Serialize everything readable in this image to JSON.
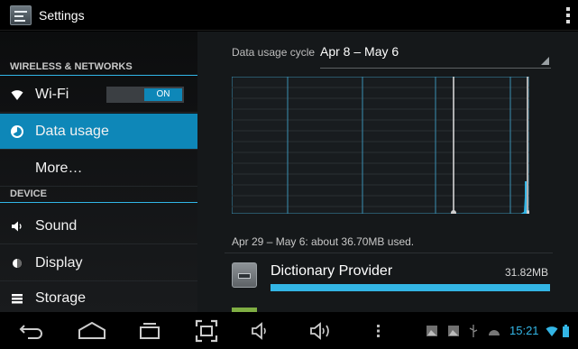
{
  "actionbar": {
    "title": "Settings"
  },
  "sidebar": {
    "sections": [
      {
        "header": "WIRELESS & NETWORKS"
      },
      {
        "header": "DEVICE"
      }
    ],
    "items": [
      {
        "label": "Wi-Fi",
        "icon": "wifi-icon",
        "toggle": "ON"
      },
      {
        "label": "Data usage",
        "icon": "data-usage-icon",
        "selected": true
      },
      {
        "label": "More…"
      },
      {
        "label": "Sound",
        "icon": "speaker-icon"
      },
      {
        "label": "Display",
        "icon": "display-icon"
      },
      {
        "label": "Storage",
        "icon": "storage-icon"
      }
    ]
  },
  "data_usage": {
    "cycle_label": "Data usage cycle",
    "cycle_value": "Apr 8 – May 6",
    "summary": "Apr 29 – May 6: about 36.70MB used.",
    "apps": [
      {
        "name": "Dictionary Provider",
        "size": "31.82MB",
        "usage_fraction": 1.0,
        "icon": "keyboard-icon"
      }
    ]
  },
  "statusbar": {
    "time": "15:21",
    "accent": "#33b5e5"
  },
  "colors": {
    "accent": "#33b5e5",
    "selected": "#0e87b8"
  }
}
